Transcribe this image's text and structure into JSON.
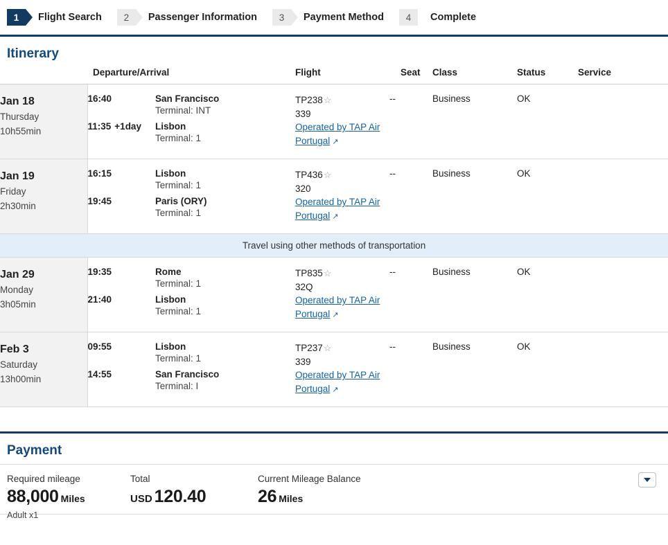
{
  "steps": [
    {
      "number": "1",
      "label": "Flight Search",
      "state": "active"
    },
    {
      "number": "2",
      "label": "Passenger Information",
      "state": "idle"
    },
    {
      "number": "3",
      "label": "Payment Method",
      "state": "idle"
    },
    {
      "number": "4",
      "label": "Complete",
      "state": "idle"
    }
  ],
  "itinerary": {
    "title": "Itinerary",
    "columns": {
      "date": "",
      "departure_arrival": "Departure/Arrival",
      "flight": "Flight",
      "seat": "Seat",
      "class": "Class",
      "status": "Status",
      "service": "Service"
    },
    "banner": "Travel using other methods of transportation",
    "rows": [
      {
        "date": "Jan 18",
        "weekday": "Thursday",
        "duration": "10h55min",
        "depart_time": "16:40",
        "depart_day_offset": "",
        "depart_place": "San Francisco",
        "depart_terminal": "Terminal: INT",
        "arrive_time": "11:35",
        "arrive_day_offset": "+1day",
        "arrive_place": "Lisbon",
        "arrive_terminal": "Terminal: 1",
        "flight_number": "TP238",
        "aircraft": "339",
        "operated_by": "Operated by TAP Air Portugal",
        "seat": "--",
        "class": "Business",
        "status": "OK",
        "service": ""
      },
      {
        "date": "Jan 19",
        "weekday": "Friday",
        "duration": "2h30min",
        "depart_time": "16:15",
        "depart_day_offset": "",
        "depart_place": "Lisbon",
        "depart_terminal": "Terminal: 1",
        "arrive_time": "19:45",
        "arrive_day_offset": "",
        "arrive_place": "Paris (ORY)",
        "arrive_terminal": "Terminal: 1",
        "flight_number": "TP436",
        "aircraft": "320",
        "operated_by": "Operated by TAP Air Portugal",
        "seat": "--",
        "class": "Business",
        "status": "OK",
        "service": ""
      },
      {
        "date": "Jan 29",
        "weekday": "Monday",
        "duration": "3h05min",
        "depart_time": "19:35",
        "depart_day_offset": "",
        "depart_place": "Rome",
        "depart_terminal": "Terminal: 1",
        "arrive_time": "21:40",
        "arrive_day_offset": "",
        "arrive_place": "Lisbon",
        "arrive_terminal": "Terminal: 1",
        "flight_number": "TP835",
        "aircraft": "32Q",
        "operated_by": "Operated by TAP Air Portugal",
        "seat": "--",
        "class": "Business",
        "status": "OK",
        "service": ""
      },
      {
        "date": "Feb 3",
        "weekday": "Saturday",
        "duration": "13h00min",
        "depart_time": "09:55",
        "depart_day_offset": "",
        "depart_place": "Lisbon",
        "depart_terminal": "Terminal: 1",
        "arrive_time": "14:55",
        "arrive_day_offset": "",
        "arrive_place": "San Francisco",
        "arrive_terminal": "Terminal: I",
        "flight_number": "TP237",
        "aircraft": "339",
        "operated_by": "Operated by TAP Air Portugal",
        "seat": "--",
        "class": "Business",
        "status": "OK",
        "service": ""
      }
    ]
  },
  "payment": {
    "title": "Payment",
    "required_mileage_label": "Required mileage",
    "required_mileage_value": "88,000",
    "required_mileage_unit": "Miles",
    "passenger_note": "Adult x1",
    "total_label": "Total",
    "total_currency": "USD",
    "total_value": "120.40",
    "balance_label": "Current Mileage Balance",
    "balance_value": "26",
    "balance_unit": "Miles"
  },
  "icons": {
    "star": "☆",
    "external_link": "↗",
    "caret_down": "caret-down-icon"
  },
  "colors": {
    "accent_navy": "#123a63",
    "heading_blue": "#14497e",
    "link_blue": "#1464a5",
    "banner_blue": "#e2eefa",
    "date_bg": "#f2f2f2"
  }
}
